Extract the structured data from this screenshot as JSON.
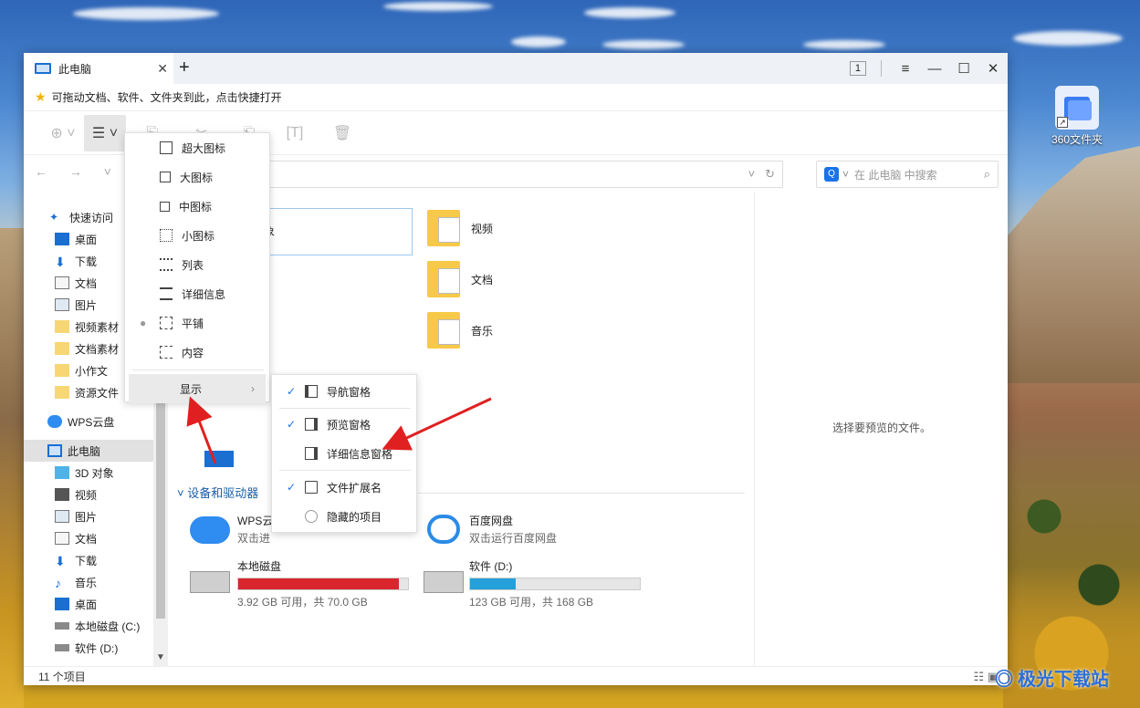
{
  "desktop": {
    "icon_label": "360文件夹"
  },
  "window": {
    "tab_title": "此电脑",
    "tab_count": "1",
    "bookmark_text": "可拖动文档、软件、文件夹到此，点击快捷打开",
    "search_placeholder": "在 此电脑 中搜索",
    "status": "11 个项目",
    "preview_text": "选择要预览的文件。"
  },
  "sidebar": {
    "items": [
      {
        "label": "快速访问",
        "icon": "star-icon"
      },
      {
        "label": "桌面",
        "icon": "desktop-icon"
      },
      {
        "label": "下载",
        "icon": "download-icon"
      },
      {
        "label": "文档",
        "icon": "document-icon"
      },
      {
        "label": "图片",
        "icon": "picture-icon"
      },
      {
        "label": "视频素材",
        "icon": "folder-icon"
      },
      {
        "label": "文档素材",
        "icon": "folder-icon"
      },
      {
        "label": "小作文",
        "icon": "folder-icon"
      },
      {
        "label": "资源文件",
        "icon": "folder-icon"
      },
      {
        "label": "WPS云盘",
        "icon": "cloud-icon"
      },
      {
        "label": "此电脑",
        "icon": "computer-icon"
      },
      {
        "label": "3D 对象",
        "icon": "cube-icon"
      },
      {
        "label": "视频",
        "icon": "video-icon"
      },
      {
        "label": "图片",
        "icon": "picture-icon"
      },
      {
        "label": "文档",
        "icon": "document-icon"
      },
      {
        "label": "下载",
        "icon": "download-icon"
      },
      {
        "label": "音乐",
        "icon": "music-icon"
      },
      {
        "label": "桌面",
        "icon": "desktop-icon"
      },
      {
        "label": "本地磁盘 (C:)",
        "icon": "drive-c-icon"
      },
      {
        "label": "软件 (D:)",
        "icon": "drive-d-icon"
      }
    ]
  },
  "content": {
    "folders": [
      {
        "label": "视频"
      },
      {
        "label": "文档"
      },
      {
        "label": "音乐"
      }
    ],
    "partial_label": "象",
    "devices_header": "设备和驱动器",
    "wps": {
      "name": "WPS云",
      "sub": "双击进"
    },
    "baidu": {
      "name": "百度网盘",
      "sub": "双击运行百度网盘"
    },
    "drive_c": {
      "name": "本地磁盘",
      "free": "3.92 GB 可用，共 70.0 GB",
      "used_fraction": 0.944,
      "color": "#d9262e"
    },
    "drive_d": {
      "name": "软件 (D:)",
      "free": "123 GB 可用，共 168 GB",
      "used_fraction": 0.268,
      "color": "#26a0da"
    }
  },
  "view_menu": {
    "items": [
      {
        "label": "超大图标"
      },
      {
        "label": "大图标"
      },
      {
        "label": "中图标"
      },
      {
        "label": "小图标"
      },
      {
        "label": "列表"
      },
      {
        "label": "详细信息"
      },
      {
        "label": "平铺",
        "selected": true
      },
      {
        "label": "内容"
      }
    ],
    "show_label": "显示",
    "show_chevron": "›"
  },
  "show_submenu": {
    "items": [
      {
        "label": "导航窗格",
        "checked": true
      },
      {
        "label": "预览窗格",
        "checked": true
      },
      {
        "label": "详细信息窗格",
        "checked": false
      },
      {
        "label": "文件扩展名",
        "checked": true
      },
      {
        "label": "隐藏的项目",
        "checked": false
      }
    ]
  },
  "colors": {
    "accent": "#1a73e8",
    "arrow": "#e02020"
  }
}
